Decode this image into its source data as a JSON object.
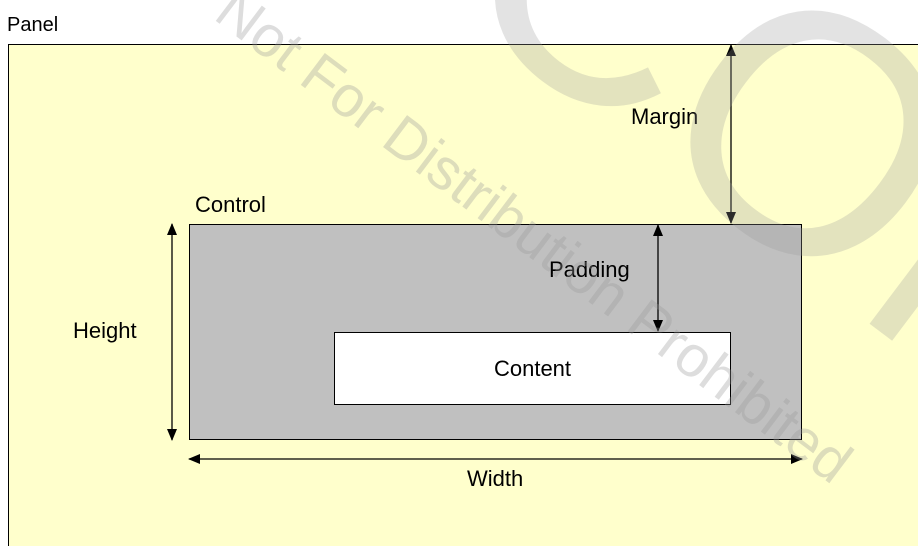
{
  "colors": {
    "panel_fill": "#ffffcc",
    "control_fill": "#c0c0c0",
    "content_fill": "#ffffff",
    "stroke": "#000000",
    "watermark_gray": "#c8c8c8",
    "watermark_olive": "#c8c89a"
  },
  "diagram": {
    "panel_label": "Panel",
    "control_label": "Control",
    "content_label": "Content",
    "margin_label": "Margin",
    "padding_label": "Padding",
    "height_label": "Height",
    "width_label": "Width"
  },
  "watermark": {
    "line1": "Not For Distribution Prohibited",
    "line2": "CON"
  }
}
